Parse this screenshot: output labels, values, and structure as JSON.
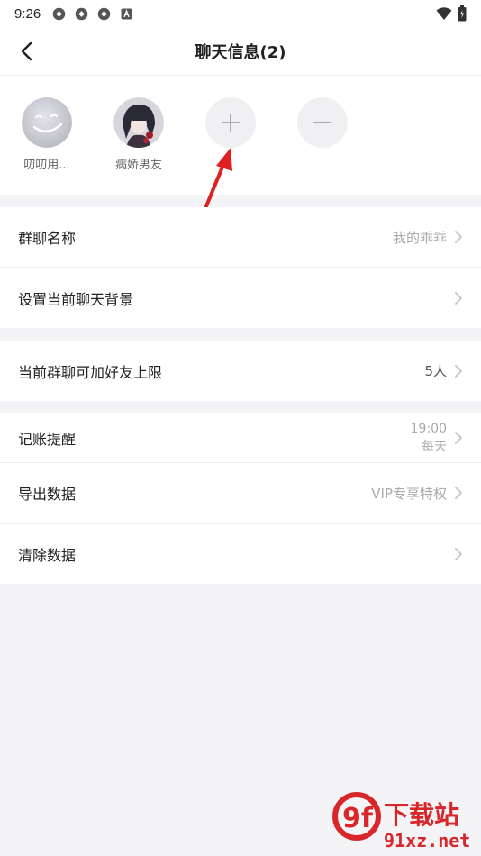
{
  "status": {
    "time": "9:26"
  },
  "nav": {
    "title": "聊天信息(2)"
  },
  "members": [
    {
      "name": "叨叨用..."
    },
    {
      "name": "病娇男友"
    }
  ],
  "settings": {
    "group_name": {
      "label": "群聊名称",
      "value": "我的乖乖"
    },
    "background": {
      "label": "设置当前聊天背景"
    },
    "friend_limit": {
      "label": "当前群聊可加好友上限",
      "value": "5人"
    },
    "reminder": {
      "label": "记账提醒",
      "time": "19:00",
      "repeat": "每天"
    },
    "export": {
      "label": "导出数据",
      "value": "VIP专享特权"
    },
    "clear": {
      "label": "清除数据"
    }
  },
  "watermark": {
    "logo": "9f",
    "brand": "下载站",
    "site": "91xz.net"
  },
  "colors": {
    "accent_arrow": "#e02020",
    "watermark_red": "#d9262b"
  }
}
